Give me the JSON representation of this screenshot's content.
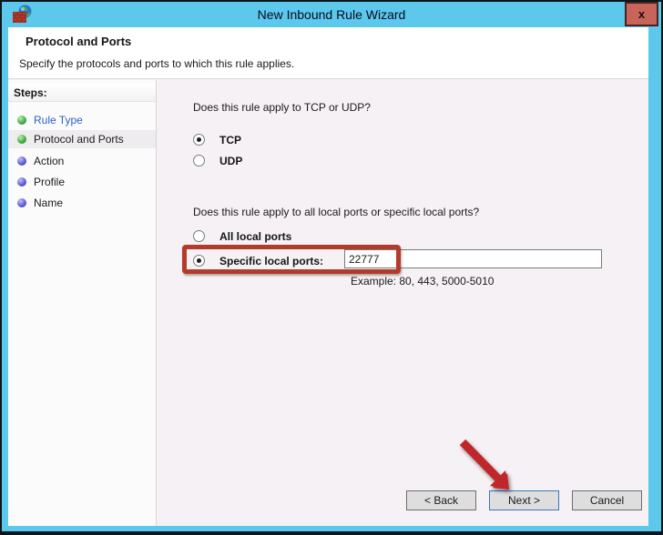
{
  "window": {
    "title": "New Inbound Rule Wizard",
    "close_button": "x"
  },
  "header": {
    "title": "Protocol and Ports",
    "subtitle": "Specify the protocols and ports to which this rule applies."
  },
  "sidebar": {
    "heading": "Steps:",
    "items": [
      {
        "label": "Rule Type",
        "bullet": "green",
        "state": "completed-link"
      },
      {
        "label": "Protocol and Ports",
        "bullet": "green",
        "state": "current"
      },
      {
        "label": "Action",
        "bullet": "purple",
        "state": "upcoming"
      },
      {
        "label": "Profile",
        "bullet": "purple",
        "state": "upcoming"
      },
      {
        "label": "Name",
        "bullet": "purple",
        "state": "upcoming"
      }
    ]
  },
  "main": {
    "question_protocol": "Does this rule apply to TCP or UDP?",
    "options_protocol": [
      {
        "label": "TCP",
        "selected": true
      },
      {
        "label": "UDP",
        "selected": false
      }
    ],
    "question_ports": "Does this rule apply to all local ports or specific local ports?",
    "options_ports": [
      {
        "label": "All local ports",
        "selected": false
      },
      {
        "label": "Specific local ports:",
        "selected": true
      }
    ],
    "port_input": {
      "value": "22777"
    },
    "example_hint": "Example: 80, 443, 5000-5010"
  },
  "footer": {
    "back_label": "< Back",
    "next_label": "Next >",
    "cancel_label": "Cancel"
  },
  "colors": {
    "titlebar_teal": "#5bc8ec",
    "frame_dark": "#0d161b",
    "close_button_red": "#c9645b",
    "content_background": "#f5f1f4",
    "annotation_red": "#b23b2b",
    "arrow_red": "#c1272a",
    "step_link_blue": "#2a62c5",
    "bullet_green": "#3da943",
    "bullet_purple": "#5959d0",
    "next_button_focus_border": "#3a79b8"
  }
}
